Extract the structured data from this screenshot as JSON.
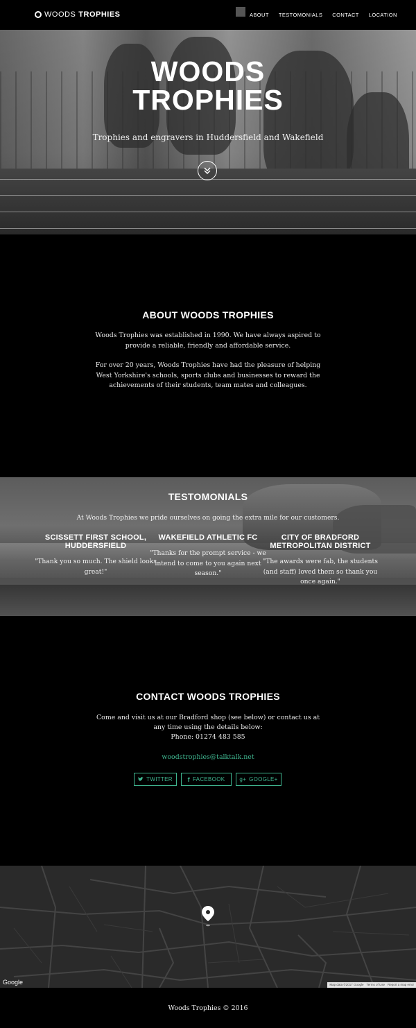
{
  "nav": {
    "brand_light": "WOODS",
    "brand_bold": "TROPHIES",
    "links": [
      "ABOUT",
      "TESTOMONIALS",
      "CONTACT",
      "LOCATION"
    ]
  },
  "hero": {
    "title_line1": "WOODS",
    "title_line2": "TROPHIES",
    "subtitle": "Trophies and engravers in Huddersfield and Wakefield",
    "scroll_icon": "double-chevron-down"
  },
  "about": {
    "title": "ABOUT WOODS TROPHIES",
    "paragraph1": "Woods Trophies was established in 1990. We have always aspired to provide a reliable, friendly and affordable service.",
    "paragraph2": "For over 20 years, Woods Trophies have had the pleasure of helping West Yorkshire's schools, sports clubs and businesses to reward the achievements of their students, team mates and colleagues."
  },
  "testimonials": {
    "title": "TESTOMONIALS",
    "intro": "At Woods Trophies we pride ourselves on going the extra mile for our customers.",
    "items": [
      {
        "name": "SCISSETT FIRST SCHOOL, HUDDERSFIELD",
        "quote": "\"Thank you so much. The shield looks great!\""
      },
      {
        "name": "WAKEFIELD ATHLETIC FC",
        "quote": "\"Thanks for the prompt service - we intend to come to you again next season.\""
      },
      {
        "name": "CITY OF BRADFORD METROPOLITAN DISTRICT",
        "quote": "\"The awards were fab, the students (and staff) loved them so thank you once again.\""
      }
    ]
  },
  "contact": {
    "title": "CONTACT WOODS TROPHIES",
    "text": "Come and visit us at our Bradford shop (see below) or contact us at any time using the details below:",
    "phone": "Phone: 01274 483 585",
    "email": "woodstrophies@talktalk.net",
    "social": [
      {
        "label": "TWITTER",
        "icon": "twitter-icon"
      },
      {
        "label": "FACEBOOK",
        "icon": "facebook-icon"
      },
      {
        "label": "GOOGLE+",
        "icon": "google-plus-icon"
      }
    ],
    "accent_color": "#3fb58f"
  },
  "map": {
    "logo": "Google",
    "attribution": [
      "Map data ©2017 Google",
      "Terms of Use",
      "Report a map error"
    ]
  },
  "footer": {
    "text": "Woods Trophies © 2016"
  }
}
